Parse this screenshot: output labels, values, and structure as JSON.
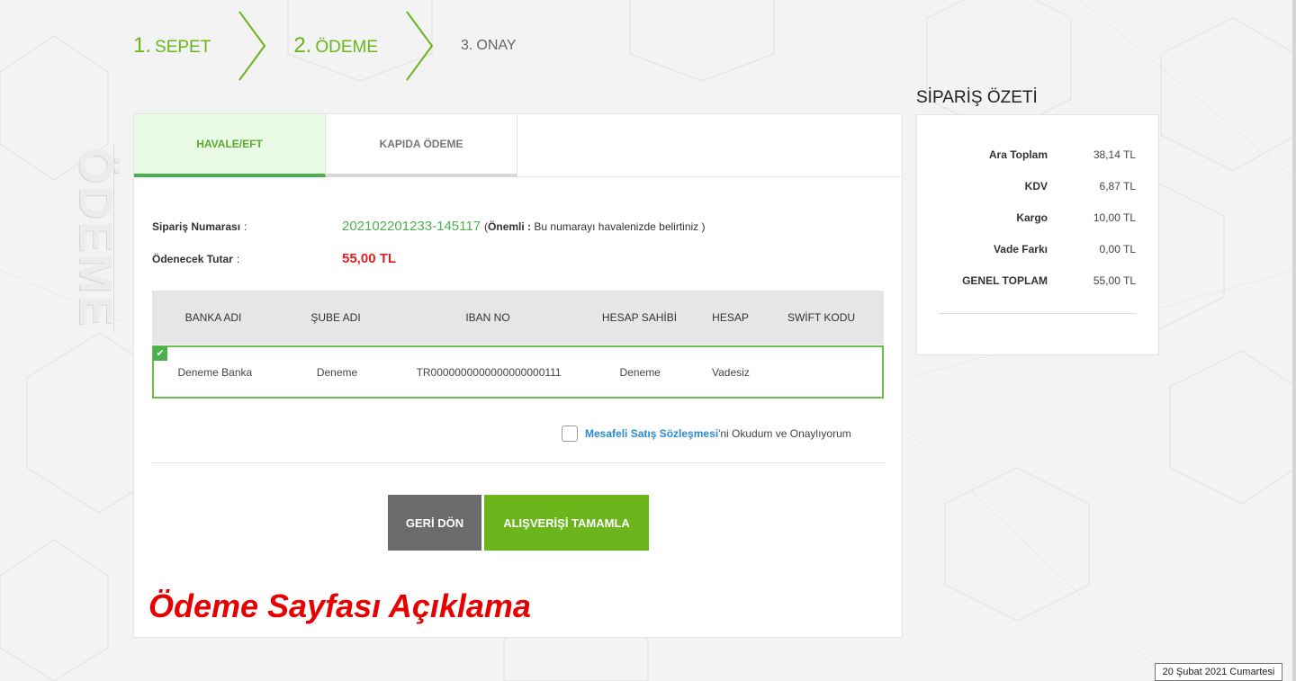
{
  "steps": [
    {
      "num": "1.",
      "label": "SEPET"
    },
    {
      "num": "2.",
      "label": "ÖDEME"
    },
    {
      "num": "3.",
      "label": "ONAY"
    }
  ],
  "side_title": "ÖDEME",
  "tabs": [
    {
      "label": "HAVALE/EFT"
    },
    {
      "label": "KAPIDA ÖDEME"
    }
  ],
  "order": {
    "number_label": "Sipariş Numarası",
    "number_value": "202102201233-145117",
    "note_open": "(",
    "note_bold": "Önemli :",
    "note_text": " Bu numarayı havalenizde belirtiniz )",
    "amount_label": "Ödenecek Tutar",
    "amount_value": "55,00 TL",
    "colon": ":"
  },
  "bank_table": {
    "headers": [
      "BANKA ADI",
      "ŞUBE ADI",
      "IBAN NO",
      "HESAP SAHİBİ",
      "HESAP",
      "SWİFT KODU"
    ],
    "rows": [
      [
        "Deneme Banka",
        "Deneme",
        "TR0000000000000000000111",
        "Deneme",
        "Vadesiz",
        ""
      ]
    ]
  },
  "contract": {
    "link": "Mesafeli Satış Sözleşmesi",
    "text": "'ni Okudum ve Onaylıyorum"
  },
  "buttons": {
    "back": "GERİ DÖN",
    "complete": "ALIŞVERİŞİ TAMAMLA"
  },
  "caption": "Ödeme Sayfası Açıklama",
  "summary": {
    "title": "SİPARİŞ ÖZETİ",
    "rows": [
      {
        "label": "Ara Toplam",
        "value": "38,14 TL"
      },
      {
        "label": "KDV",
        "value": "6,87 TL"
      },
      {
        "label": "Kargo",
        "value": "10,00 TL"
      },
      {
        "label": "Vade Farkı",
        "value": "0,00 TL"
      },
      {
        "label": "GENEL TOPLAM",
        "value": "55,00 TL"
      }
    ]
  },
  "date": "20 Şubat 2021 Cumartesi",
  "colors": {
    "accent_green": "#6cb41c",
    "price_red": "#e02020",
    "link_blue": "#2a8ad6",
    "caption_red": "#e80000"
  }
}
